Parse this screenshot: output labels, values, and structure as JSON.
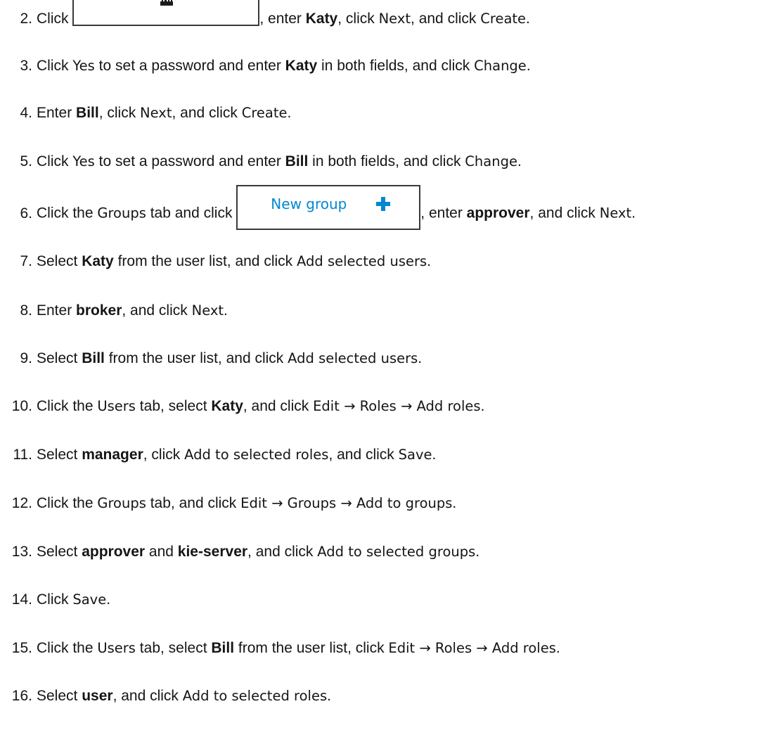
{
  "steps": [
    {
      "number": "2.",
      "parts": [
        {
          "t": "text",
          "v": "Click "
        },
        {
          "t": "button-image",
          "kind": "new-user"
        },
        {
          "t": "text",
          "v": ", enter "
        },
        {
          "t": "input",
          "v": "Katy"
        },
        {
          "t": "text",
          "v": ", click "
        },
        {
          "t": "ui",
          "v": "Next"
        },
        {
          "t": "text",
          "v": ", and click "
        },
        {
          "t": "ui",
          "v": "Create"
        },
        {
          "t": "text",
          "v": "."
        }
      ]
    },
    {
      "number": "3.",
      "parts": [
        {
          "t": "text",
          "v": "Click "
        },
        {
          "t": "ui",
          "v": "Yes"
        },
        {
          "t": "text",
          "v": " to set a password and enter  "
        },
        {
          "t": "input",
          "v": "Katy"
        },
        {
          "t": "text",
          "v": " in both fields, and click  "
        },
        {
          "t": "ui",
          "v": "Change"
        },
        {
          "t": "text",
          "v": "."
        }
      ]
    },
    {
      "number": "4.",
      "parts": [
        {
          "t": "text",
          "v": "Enter "
        },
        {
          "t": "input",
          "v": "Bill"
        },
        {
          "t": "text",
          "v": ", click "
        },
        {
          "t": "ui",
          "v": "Next"
        },
        {
          "t": "text",
          "v": ", and click "
        },
        {
          "t": "ui",
          "v": "Create"
        },
        {
          "t": "text",
          "v": "."
        }
      ]
    },
    {
      "number": "5.",
      "parts": [
        {
          "t": "text",
          "v": "Click "
        },
        {
          "t": "ui",
          "v": "Yes"
        },
        {
          "t": "text",
          "v": " to set a password and enter  "
        },
        {
          "t": "input",
          "v": "Bill"
        },
        {
          "t": "text",
          "v": " in both fields, and click  "
        },
        {
          "t": "ui",
          "v": "Change"
        },
        {
          "t": "text",
          "v": "."
        }
      ]
    },
    {
      "number": "6.",
      "parts": [
        {
          "t": "text",
          "v": "Click the "
        },
        {
          "t": "ui",
          "v": "Groups"
        },
        {
          "t": "text",
          "v": " tab and click "
        },
        {
          "t": "button-image",
          "kind": "new-group",
          "label": "New group"
        },
        {
          "t": "text",
          "v": ", enter "
        },
        {
          "t": "input",
          "v": "approver"
        },
        {
          "t": "text",
          "v": ", and click "
        },
        {
          "t": "ui",
          "v": "Next"
        },
        {
          "t": "text",
          "v": "."
        }
      ]
    },
    {
      "number": "7.",
      "parts": [
        {
          "t": "text",
          "v": "Select "
        },
        {
          "t": "input",
          "v": "Katy"
        },
        {
          "t": "text",
          "v": " from the user list, and click  "
        },
        {
          "t": "ui",
          "v": "Add selected users"
        },
        {
          "t": "text",
          "v": "."
        }
      ]
    },
    {
      "number": "8.",
      "parts": [
        {
          "t": "text",
          "v": "Enter "
        },
        {
          "t": "input",
          "v": "broker"
        },
        {
          "t": "text",
          "v": ", and click "
        },
        {
          "t": "ui",
          "v": "Next"
        },
        {
          "t": "text",
          "v": "."
        }
      ]
    },
    {
      "number": "9.",
      "parts": [
        {
          "t": "text",
          "v": "Select "
        },
        {
          "t": "input",
          "v": "Bill"
        },
        {
          "t": "text",
          "v": " from the user list, and click  "
        },
        {
          "t": "ui",
          "v": "Add selected users"
        },
        {
          "t": "text",
          "v": "."
        }
      ]
    },
    {
      "number": "10.",
      "parts": [
        {
          "t": "text",
          "v": "Click the "
        },
        {
          "t": "ui",
          "v": "Users"
        },
        {
          "t": "text",
          "v": " tab, select  "
        },
        {
          "t": "input",
          "v": "Katy"
        },
        {
          "t": "text",
          "v": ", and click "
        },
        {
          "t": "ui",
          "v": "Edit → Roles → Add roles"
        },
        {
          "t": "text",
          "v": "."
        }
      ]
    },
    {
      "number": "11.",
      "parts": [
        {
          "t": "text",
          "v": "Select "
        },
        {
          "t": "input",
          "v": "manager"
        },
        {
          "t": "text",
          "v": ", click "
        },
        {
          "t": "ui",
          "v": "Add to selected roles"
        },
        {
          "t": "text",
          "v": ", and click "
        },
        {
          "t": "ui",
          "v": "Save"
        },
        {
          "t": "text",
          "v": "."
        }
      ]
    },
    {
      "number": "12.",
      "parts": [
        {
          "t": "text",
          "v": "Click the "
        },
        {
          "t": "ui",
          "v": "Groups"
        },
        {
          "t": "text",
          "v": " tab, and click  "
        },
        {
          "t": "ui",
          "v": "Edit → Groups → Add to groups"
        },
        {
          "t": "text",
          "v": "."
        }
      ]
    },
    {
      "number": "13.",
      "parts": [
        {
          "t": "text",
          "v": "Select "
        },
        {
          "t": "input",
          "v": "approver"
        },
        {
          "t": "text",
          "v": " and "
        },
        {
          "t": "input",
          "v": "kie-server"
        },
        {
          "t": "text",
          "v": ", and click "
        },
        {
          "t": "ui",
          "v": "Add to selected groups"
        },
        {
          "t": "text",
          "v": "."
        }
      ]
    },
    {
      "number": "14.",
      "parts": [
        {
          "t": "text",
          "v": "Click "
        },
        {
          "t": "ui",
          "v": "Save"
        },
        {
          "t": "text",
          "v": "."
        }
      ]
    },
    {
      "number": "15.",
      "parts": [
        {
          "t": "text",
          "v": "Click the "
        },
        {
          "t": "ui",
          "v": "Users"
        },
        {
          "t": "text",
          "v": " tab, select  "
        },
        {
          "t": "input",
          "v": "Bill"
        },
        {
          "t": "text",
          "v": " from the user list, click  "
        },
        {
          "t": "ui",
          "v": "Edit → Roles → Add roles"
        },
        {
          "t": "text",
          "v": "."
        }
      ]
    },
    {
      "number": "16.",
      "parts": [
        {
          "t": "text",
          "v": "Select "
        },
        {
          "t": "input",
          "v": "user"
        },
        {
          "t": "text",
          "v": ", and click "
        },
        {
          "t": "ui",
          "v": "Add to selected roles"
        },
        {
          "t": "text",
          "v": "."
        }
      ]
    }
  ],
  "colors": {
    "text": "#151515",
    "button_border": "#3a3a3a",
    "new_group_accent": "#0088ce"
  }
}
